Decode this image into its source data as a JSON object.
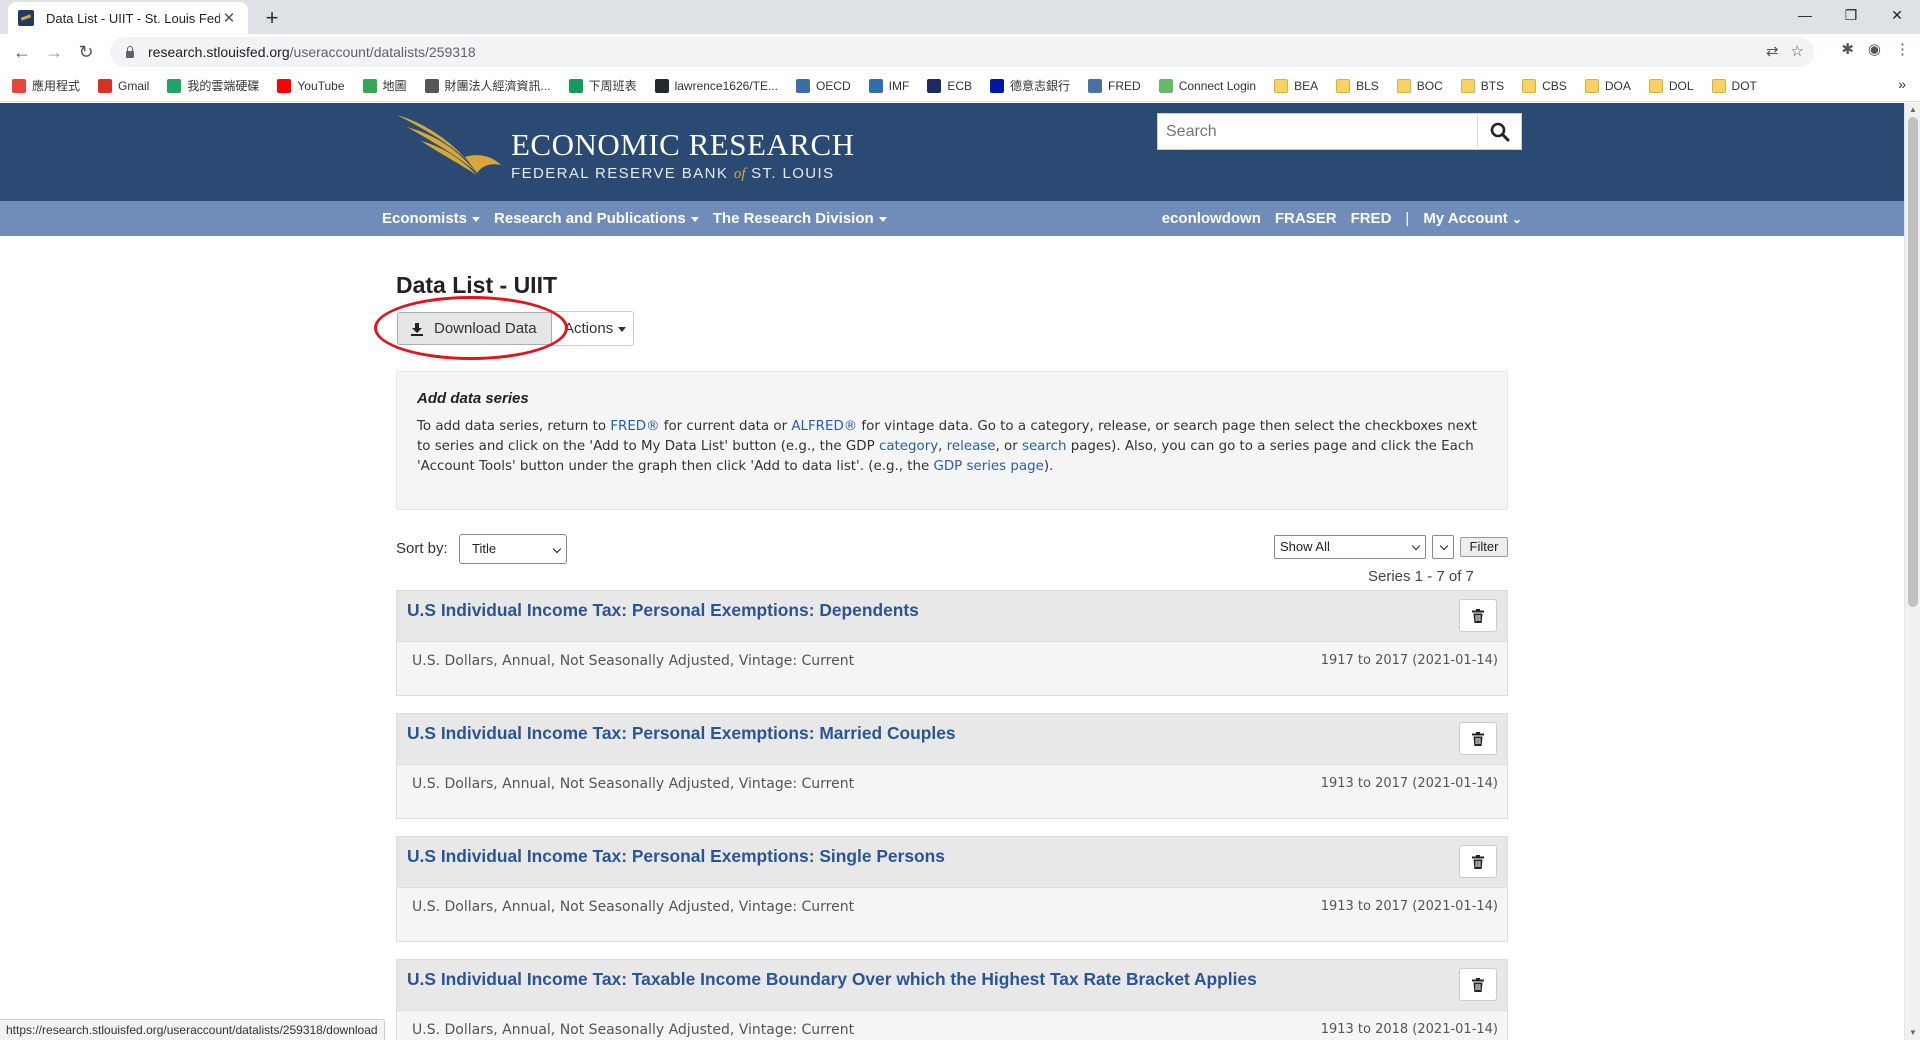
{
  "browser": {
    "tab_title": "Data List - UIIT - St. Louis Fed",
    "url_host": "research.stlouisfed.org",
    "url_path": "/useraccount/datalists/259318",
    "status_url": "https://research.stlouisfed.org/useraccount/datalists/259318/download",
    "bookmarks": [
      {
        "label": "應用程式",
        "icon": "apps-grid-icon",
        "color": "#e8453c"
      },
      {
        "label": "Gmail",
        "icon": "gmail-icon",
        "color": "#d93025"
      },
      {
        "label": "我的雲端硬碟",
        "icon": "drive-icon",
        "color": "#1fa463"
      },
      {
        "label": "YouTube",
        "icon": "youtube-icon",
        "color": "#ff0000"
      },
      {
        "label": "地圖",
        "icon": "maps-icon",
        "color": "#34a853"
      },
      {
        "label": "財團法人經濟資訊...",
        "icon": "globe-icon",
        "color": "#555555"
      },
      {
        "label": "下周班表",
        "icon": "sheets-icon",
        "color": "#0f9d58"
      },
      {
        "label": "lawrence1626/TE...",
        "icon": "github-icon",
        "color": "#24292e"
      },
      {
        "label": "OECD",
        "icon": "oecd-icon",
        "color": "#3a6ea5"
      },
      {
        "label": "IMF",
        "icon": "imf-icon",
        "color": "#2f6db5"
      },
      {
        "label": "ECB",
        "icon": "ecb-icon",
        "color": "#1d2b64"
      },
      {
        "label": "德意志銀行",
        "icon": "bank-icon",
        "color": "#0018a8"
      },
      {
        "label": "FRED",
        "icon": "fred-icon",
        "color": "#4a6fa5"
      },
      {
        "label": "Connect Login",
        "icon": "connect-icon",
        "color": "#66bb6a"
      },
      {
        "label": "BEA",
        "icon": "folder-icon",
        "color": "#f6d365"
      },
      {
        "label": "BLS",
        "icon": "folder-icon",
        "color": "#f6d365"
      },
      {
        "label": "BOC",
        "icon": "folder-icon",
        "color": "#f6d365"
      },
      {
        "label": "BTS",
        "icon": "folder-icon",
        "color": "#f6d365"
      },
      {
        "label": "CBS",
        "icon": "folder-icon",
        "color": "#f6d365"
      },
      {
        "label": "DOA",
        "icon": "folder-icon",
        "color": "#f6d365"
      },
      {
        "label": "DOL",
        "icon": "folder-icon",
        "color": "#f6d365"
      },
      {
        "label": "DOT",
        "icon": "folder-icon",
        "color": "#f6d365"
      }
    ]
  },
  "header": {
    "logo_title": "ECONOMIC RESEARCH",
    "logo_sub_1": "FEDERAL RESERVE BANK",
    "logo_sub_of": "of",
    "logo_sub_2": "ST. LOUIS",
    "search_placeholder": "Search",
    "brand_color": "#2b4a73",
    "nav_color": "#6f8db8",
    "accent_color": "#d7a73a"
  },
  "nav": {
    "left": [
      "Economists",
      "Research and Publications",
      "The Research Division"
    ],
    "right": [
      "econlowdown",
      "FRASER",
      "FRED"
    ],
    "separator": "|",
    "account": "My Account"
  },
  "main": {
    "title": "Data List - UIIT",
    "download_label": "Download Data",
    "actions_label": "Actions",
    "info_heading": "Add data series",
    "info": {
      "t1": "To add data series, return to ",
      "fred": "FRED®",
      "t2": " for current data or ",
      "alfred": "ALFRED®",
      "t3": " for vintage data. Go to a category, release, or search page then select the checkboxes next to series and click on the 'Add to My Data List' button (e.g., the GDP ",
      "category": "category",
      "t4": ", ",
      "release": "release",
      "t5": ", or ",
      "search": "search",
      "t6": " pages). Also, you can go to a series page and click the Each 'Account Tools' button under the graph then click 'Add to data list'. (e.g., the ",
      "gdp_page": "GDP series page",
      "t7": ")."
    },
    "sort_label": "Sort by:",
    "sort_value": "Title",
    "show_value": "Show All",
    "filter_label": "Filter",
    "series_count": "Series 1 - 7 of 7",
    "link_color": "#2a5db0",
    "series": [
      {
        "title": "U.S Individual Income Tax: Personal Exemptions: Dependents",
        "meta": "U.S. Dollars, Annual, Not Seasonally Adjusted, Vintage: Current",
        "range": "1917 to 2017 (2021-01-14)"
      },
      {
        "title": "U.S Individual Income Tax: Personal Exemptions: Married Couples",
        "meta": "U.S. Dollars, Annual, Not Seasonally Adjusted, Vintage: Current",
        "range": "1913 to 2017 (2021-01-14)"
      },
      {
        "title": "U.S Individual Income Tax: Personal Exemptions: Single Persons",
        "meta": "U.S. Dollars, Annual, Not Seasonally Adjusted, Vintage: Current",
        "range": "1913 to 2017 (2021-01-14)"
      },
      {
        "title": "U.S Individual Income Tax: Taxable Income Boundary Over which the Highest Tax Rate Bracket Applies",
        "meta": "U.S. Dollars, Annual, Not Seasonally Adjusted, Vintage: Current",
        "range": "1913 to 2018 (2021-01-14)"
      }
    ]
  }
}
